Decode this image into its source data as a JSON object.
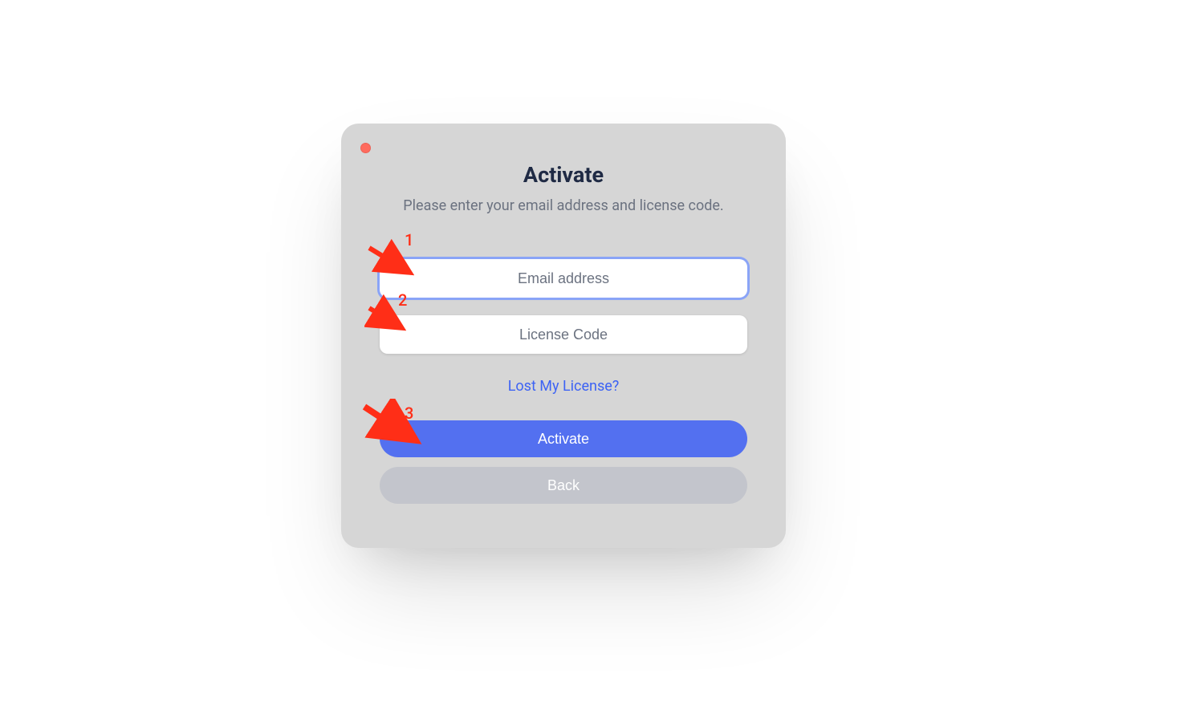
{
  "window": {
    "title": "Activate",
    "subtitle": "Please enter your email address and license code."
  },
  "fields": {
    "email_placeholder": "Email address",
    "license_placeholder": "License Code"
  },
  "links": {
    "lost_license": "Lost My License?"
  },
  "buttons": {
    "activate": "Activate",
    "back": "Back"
  },
  "annotations": {
    "one": "1",
    "two": "2",
    "three": "3"
  },
  "colors": {
    "accent": "#5370f0",
    "annotation": "#ff2e17",
    "close_dot": "#ff6b5e"
  }
}
